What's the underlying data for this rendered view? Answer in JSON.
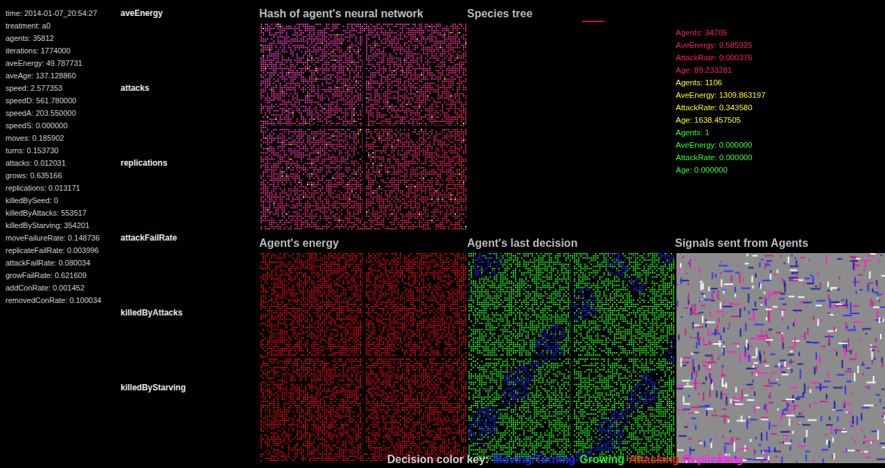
{
  "stats": [
    "time: 2014-01-07_20:54:27",
    "treatment: a0",
    "agents: 35812",
    "iterations: 1774000",
    "aveEnergy: 49.787731",
    "aveAge: 137.128860",
    "speed: 2.577353",
    "speedD: 561.780000",
    "speedA: 203.550000",
    "speedS: 0.000000",
    "moves: 0.185902",
    "turns: 0.153730",
    "attacks: 0.012031",
    "grows: 0.635166",
    "replications: 0.013171",
    "killedBySeed: 0",
    "killedByAttacks: 553517",
    "killedByStarving: 354201",
    "moveFailureRate: 0.148736",
    "replicateFailRate: 0.003996",
    "attackFailRate: 0.080034",
    "growFailRate: 0.621609",
    "addConRate: 0.001452",
    "removedConRate: 0.100034"
  ],
  "chart_labels": [
    "aveEnergy",
    "attacks",
    "replications",
    "attackFailRate",
    "killedByAttacks",
    "killedByStarving"
  ],
  "panels": [
    {
      "title": "Hash of agent's neural network",
      "kind": "hash"
    },
    {
      "title": "Species tree",
      "kind": "tree"
    },
    {
      "title": "",
      "kind": "species"
    },
    {
      "title": "Agent's energy",
      "kind": "energy"
    },
    {
      "title": "Agent's last decision",
      "kind": "decision"
    },
    {
      "title": "Signals sent from Agents",
      "kind": "signals"
    }
  ],
  "species": [
    {
      "color": "#ff1f5a",
      "lines": [
        "Agents: 34705",
        "AveEnergy: 9.585925",
        "AttackRate: 0.000375",
        "Age: 89.233281"
      ]
    },
    {
      "color": "#ffff22",
      "lines": [
        "Agents: 1106",
        "AveEnergy: 1309.863197",
        "AttackRate: 0.343580",
        "Age: 1638.457505"
      ]
    },
    {
      "color": "#33ff33",
      "lines": [
        "Agents: 1",
        "AveEnergy: 0.000000",
        "AttackRate: 0.000000",
        "Age: 0.000000"
      ]
    }
  ],
  "decision_key": {
    "label": "Decision color key:",
    "items": [
      {
        "text": "Moving/Turning",
        "color": "#2424ff"
      },
      {
        "text": "Growing",
        "color": "#22ee22"
      },
      {
        "text": "Attacking",
        "color": "#ff2222"
      },
      {
        "text": "Replicating",
        "color": "#ff22ff"
      }
    ]
  }
}
